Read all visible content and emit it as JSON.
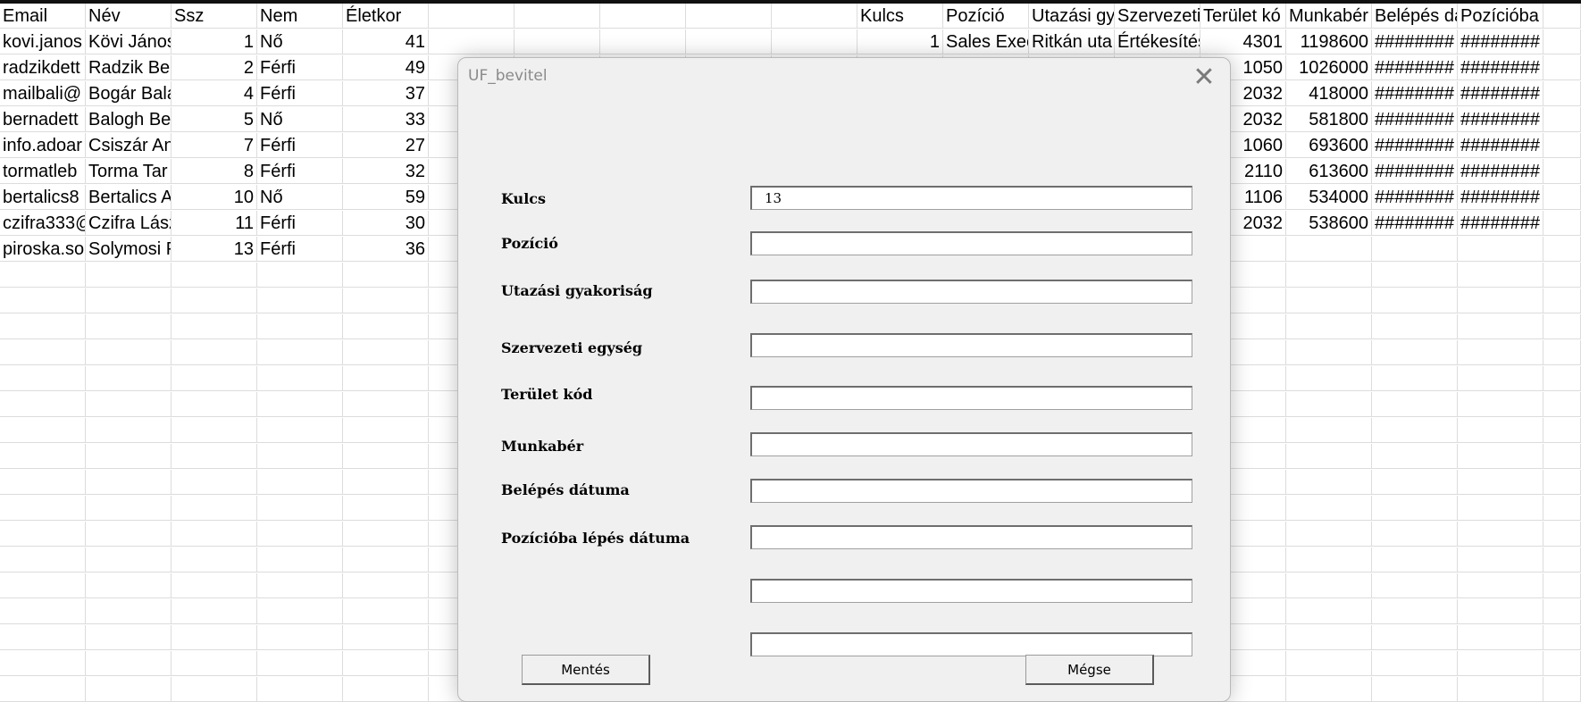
{
  "sheet": {
    "left_headers": [
      "Email",
      "Név",
      "Ssz",
      "Nem",
      "Életkor"
    ],
    "right_headers": [
      "Kulcs",
      "Pozíció",
      "Utazási gy",
      "Szervezeti",
      "Terület kó",
      "Munkabér",
      "Belépés da",
      "Pozícióba lépés"
    ],
    "left_rows": [
      [
        "kovi.janos",
        "Kövi János",
        "1",
        "Nő",
        "41"
      ],
      [
        "radzikdett",
        "Radzik Ber",
        "2",
        "Férfi",
        "49"
      ],
      [
        "mailbali@",
        "Bogár Bala",
        "4",
        "Férfi",
        "37"
      ],
      [
        "bernadett",
        "Balogh Ber",
        "5",
        "Nő",
        "33"
      ],
      [
        "info.adoar",
        "Csiszár An",
        "7",
        "Férfi",
        "27"
      ],
      [
        "tormatleb",
        "Torma Tar",
        "8",
        "Férfi",
        "32"
      ],
      [
        "bertalics8",
        "Bertalics A",
        "10",
        "Nő",
        "59"
      ],
      [
        "czifra333@",
        "Czifra Lász",
        "11",
        "Férfi",
        "30"
      ],
      [
        "piroska.so",
        "Solymosi P",
        "13",
        "Férfi",
        "36"
      ]
    ],
    "right_first_row": [
      "1",
      "Sales Exec",
      "Ritkán uta",
      "Értékesítés"
    ],
    "right_tail_rows": [
      [
        "4301",
        "1198600",
        "########",
        "########"
      ],
      [
        "1050",
        "1026000",
        "########",
        "########"
      ],
      [
        "2032",
        "418000",
        "########",
        "########"
      ],
      [
        "2032",
        "581800",
        "########",
        "########"
      ],
      [
        "1060",
        "693600",
        "########",
        "########"
      ],
      [
        "2110",
        "613600",
        "########",
        "########"
      ],
      [
        "1106",
        "534000",
        "########",
        "########"
      ],
      [
        "2032",
        "538600",
        "########",
        "########"
      ]
    ]
  },
  "dialog": {
    "title": "UF_bevitel",
    "close_glyph": "✕",
    "labels": [
      "Kulcs",
      "Pozíció",
      "Utazási gyakoriság",
      "Szervezeti egység",
      "Terület kód",
      "Munkabér",
      "Belépés dátuma",
      "Pozícióba lépés dátuma"
    ],
    "fields": [
      "13",
      "",
      "",
      "",
      "",
      "",
      "",
      "",
      "",
      ""
    ],
    "save_label": "Mentés",
    "cancel_label": "Mégse"
  }
}
